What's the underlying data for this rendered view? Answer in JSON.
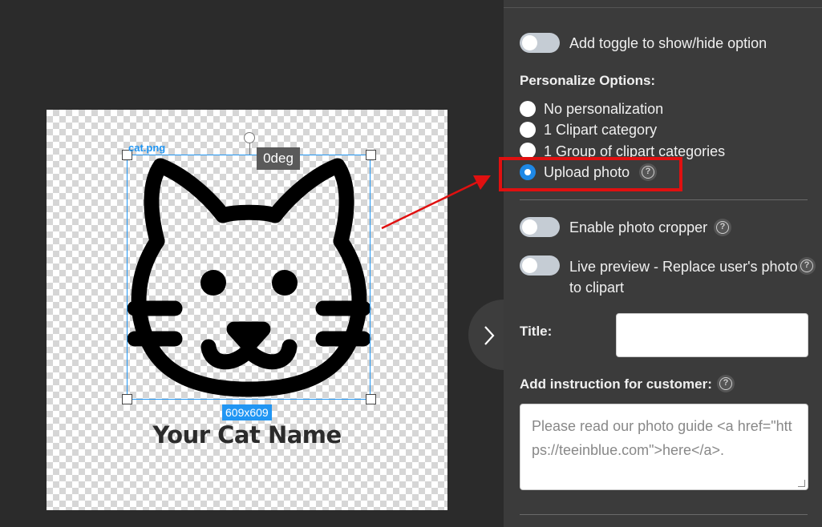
{
  "canvas": {
    "file_name": "cat.png",
    "rotation": "0deg",
    "size": "609x609",
    "cat_name": "Your Cat Name"
  },
  "panel": {
    "toggle_show_hide_label": "Add toggle to show/hide option",
    "personalize_heading": "Personalize Options:",
    "options": [
      {
        "label": "No personalization",
        "selected": false
      },
      {
        "label": "1 Clipart category",
        "selected": false
      },
      {
        "label": "1 Group of clipart categories",
        "selected": false
      },
      {
        "label": "Upload photo",
        "selected": true
      }
    ],
    "photo_cropper_label": "Enable photo cropper",
    "live_preview_label_line1": "Live preview - Replace user's photo",
    "live_preview_label_line2": "to clipart",
    "title_label": "Title:",
    "title_value": "",
    "instruction_label": "Add instruction for customer:",
    "instruction_placeholder": "Please read our photo guide <a href=\"https://teeinblue.com\">here</a>.",
    "help_glyph": "?"
  },
  "colors": {
    "accent": "#2196f3",
    "radio_selected": "#1e88e5",
    "highlight_red": "#e01010",
    "panel_bg": "#3b3b3b",
    "canvas_bg": "#2b2b2b"
  },
  "icons": [
    "question-circle-icon",
    "chevron-right-icon",
    "red-arrow"
  ]
}
